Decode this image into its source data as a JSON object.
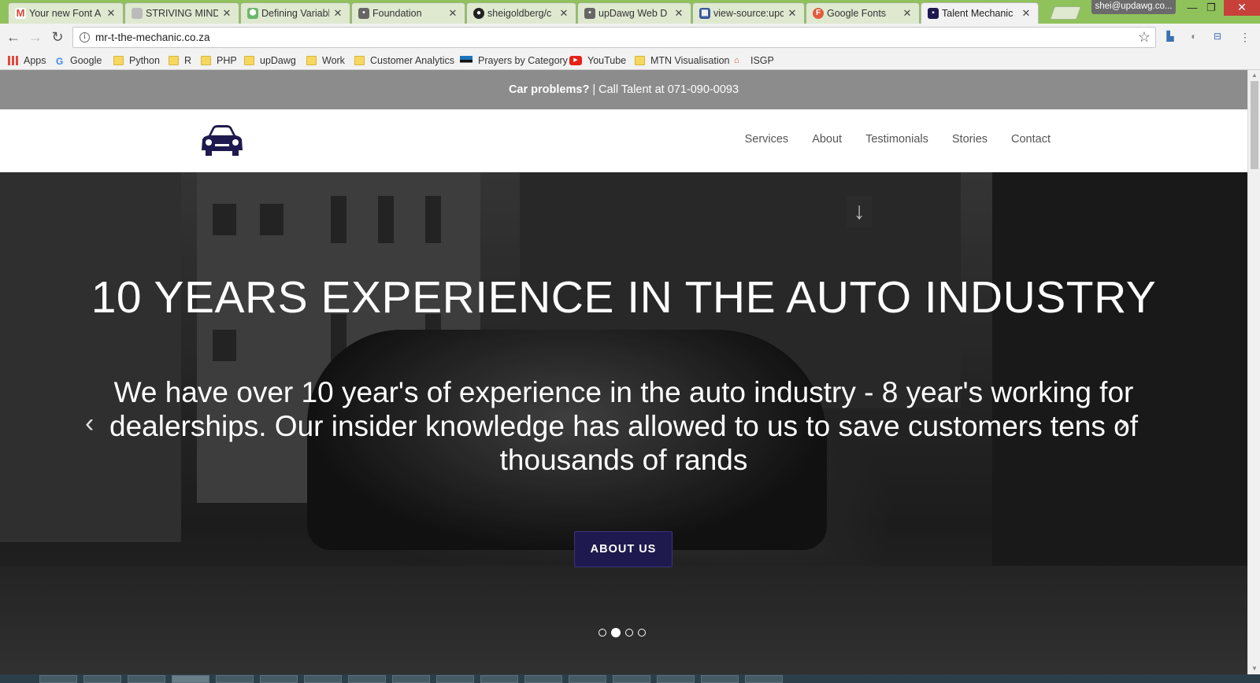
{
  "browser": {
    "tabs": [
      {
        "title": "Your new Font A",
        "favicon": "gmail-icon",
        "color": "#d44638"
      },
      {
        "title": "STRIVING MIND",
        "favicon": "page-icon",
        "color": "#9aa0a6"
      },
      {
        "title": "Defining Variabl",
        "favicon": "hexagon-icon",
        "color": "#6cb66c"
      },
      {
        "title": "Foundation",
        "favicon": "dog-icon",
        "color": "#555555"
      },
      {
        "title": "sheigoldberg/c",
        "favicon": "github-icon",
        "color": "#222222"
      },
      {
        "title": "upDawg Web D",
        "favicon": "dog-icon",
        "color": "#555555"
      },
      {
        "title": "view-source:upc",
        "favicon": "grid-icon",
        "color": "#3b5998"
      },
      {
        "title": "Google Fonts",
        "favicon": "google-fonts-icon",
        "color": "#e35b3c"
      },
      {
        "title": "Talent Mechanic",
        "favicon": "car-icon",
        "color": "#1e1a4f"
      }
    ],
    "profile_label": "shei@updawg.co...",
    "url": "mr-t-the-mechanic.co.za",
    "bookmarks": [
      {
        "label": "Apps",
        "icon": "apps-grid-icon"
      },
      {
        "label": "Google",
        "icon": "google-icon"
      },
      {
        "label": "Python",
        "icon": "folder-icon"
      },
      {
        "label": "R",
        "icon": "folder-icon"
      },
      {
        "label": "PHP",
        "icon": "folder-icon"
      },
      {
        "label": "upDawg",
        "icon": "folder-icon"
      },
      {
        "label": "Work",
        "icon": "folder-icon"
      },
      {
        "label": "Customer Analytics",
        "icon": "folder-icon"
      },
      {
        "label": "Prayers by Category",
        "icon": "flag-icon"
      },
      {
        "label": "YouTube",
        "icon": "youtube-icon"
      },
      {
        "label": "MTN Visualisation",
        "icon": "folder-icon"
      },
      {
        "label": "ISGP",
        "icon": "isgp-icon"
      }
    ]
  },
  "site": {
    "topbar": {
      "bold": "Car problems?",
      "rest": " | Call Talent at 071-090-0093"
    },
    "nav": [
      "Services",
      "About",
      "Testimonials",
      "Stories",
      "Contact"
    ],
    "brand_color": "#1e1a4f",
    "hero": {
      "title": "10 YEARS EXPERIENCE IN THE AUTO INDUSTRY",
      "text": "We have over 10 year's of experience in the auto industry - 8 year's working for dealerships. Our insider knowledge has allowed to us to save customers tens of thousands of rands",
      "button": "ABOUT US",
      "prev": "‹",
      "next": "›",
      "slides_total": 4,
      "slide_active": 2
    }
  }
}
